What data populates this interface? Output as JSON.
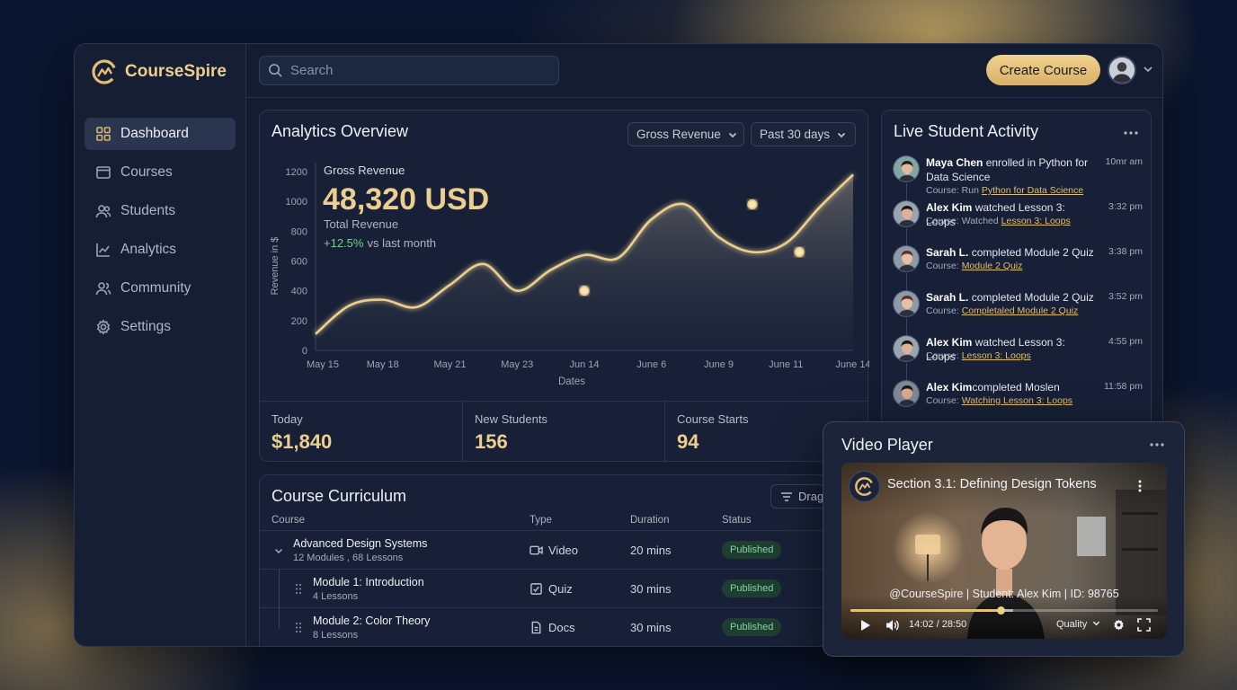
{
  "brand": {
    "name": "CourseSpire"
  },
  "colors": {
    "accent": "#e6c079",
    "background": "#0b1630",
    "panel": "#172036",
    "success": "#7fd6a0"
  },
  "sidebar": {
    "items": [
      {
        "label": "Dashboard",
        "icon": "dashboard-icon",
        "active": true
      },
      {
        "label": "Courses",
        "icon": "courses-icon"
      },
      {
        "label": "Students",
        "icon": "students-icon"
      },
      {
        "label": "Analytics",
        "icon": "analytics-icon"
      },
      {
        "label": "Community",
        "icon": "community-icon"
      },
      {
        "label": "Settings",
        "icon": "settings-icon"
      }
    ]
  },
  "topbar": {
    "search_placeholder": "Search",
    "create_label": "Create Course"
  },
  "analytics": {
    "title": "Analytics Overview",
    "metric_dropdown": "Gross Revenue",
    "range_dropdown": "Past 30 days",
    "overlay_label": "Gross Revenue",
    "overlay_value": "48,320 USD",
    "overlay_sub": "Total Revenue",
    "overlay_change": "+12.5%",
    "overlay_change_suffix": "vs last month"
  },
  "chart_data": {
    "type": "area",
    "title": "",
    "xlabel": "Dates",
    "ylabel": "Revenue in $",
    "ylim": [
      0,
      1200
    ],
    "yticks": [
      0,
      200,
      400,
      600,
      800,
      1000,
      1200
    ],
    "categories": [
      "May 15",
      "May 18",
      "May 21",
      "May 23",
      "Jun 14",
      "June 6",
      "June 9",
      "June 11",
      "June 14"
    ],
    "x": [
      0,
      0.5,
      1,
      1.5,
      2,
      2.5,
      3,
      3.5,
      4,
      4.5,
      5,
      5.5,
      6,
      6.5,
      7,
      7.5,
      8
    ],
    "values": [
      110,
      300,
      340,
      290,
      440,
      580,
      400,
      540,
      640,
      620,
      880,
      980,
      760,
      660,
      720,
      960,
      1180
    ],
    "highlighted": [
      {
        "x": 4,
        "value": 400
      },
      {
        "x": 6.5,
        "value": 980
      },
      {
        "x": 7.2,
        "value": 660
      }
    ],
    "grid": false
  },
  "stats": [
    {
      "label": "Today",
      "value": "$1,840"
    },
    {
      "label": "New Students",
      "value": "156"
    },
    {
      "label": "Course Starts",
      "value": "94"
    }
  ],
  "activity": {
    "title": "Live Student Activity",
    "items": [
      {
        "name": "Maya Chen",
        "action": " enrolled in Python for Data Science",
        "sub_prefix": "Course: Run ",
        "sub_link": "Python for Data Science",
        "time": "10mr am",
        "avatar": "female-1"
      },
      {
        "name": "Alex Kim",
        "action": " watched Lesson 3: Loops",
        "sub_prefix": "Course: Watched ",
        "sub_link": "Lesson 3: Loops",
        "time": "3:32 pm",
        "avatar": "male-1"
      },
      {
        "name": "Sarah L.",
        "action": " completed Module 2 Quiz",
        "sub_prefix": "Course: ",
        "sub_link": "Module 2 Quiz",
        "time": "3:38 pm",
        "avatar": "female-2"
      },
      {
        "name": "Sarah L.",
        "action": " completed Module 2 Quiz",
        "sub_prefix": "Course: ",
        "sub_link": "Completaled Module 2 Quiz",
        "time": "3:52 pm",
        "avatar": "female-2"
      },
      {
        "name": "Alex Kim",
        "action": " watched Lesson 3: Loops",
        "sub_prefix": "Course: ",
        "sub_link": "Lesson 3: Loops",
        "time": "4:55 pm",
        "avatar": "male-1"
      },
      {
        "name": "Alex Kim",
        "action": "completed Moslen",
        "sub_prefix": "Course: ",
        "sub_link": "Watching Lesson 3: Loops",
        "time": "11:58 pm",
        "avatar": "male-2"
      }
    ]
  },
  "curriculum": {
    "title": "Course Curriculum",
    "filter_label": "Drag",
    "headers": [
      "Course",
      "Type",
      "Duration",
      "Status"
    ],
    "rows": [
      {
        "name": "Advanced Design Systems",
        "sub": "12 Modules , 68 Lessons",
        "type": "Video",
        "type_icon": "video-icon",
        "duration": "20 mins",
        "status": "Published",
        "level": 0
      },
      {
        "name": "Module 1: Introduction",
        "sub": "4 Lessons",
        "type": "Quiz",
        "type_icon": "quiz-icon",
        "duration": "30 mins",
        "status": "Published",
        "level": 1
      },
      {
        "name": "Module 2: Color Theory",
        "sub": "8 Lessons",
        "type": "Docs",
        "type_icon": "docs-icon",
        "duration": "30 mins",
        "status": "Published",
        "level": 1
      }
    ]
  },
  "video": {
    "title": "Video Player",
    "section_title": "Section 3.1: Defining Design Tokens",
    "watermark": "@CourseSpire | Student: Alex Kim | ID: 98765",
    "time": "14:02 / 28:50",
    "quality": "Quality",
    "progress": 0.49,
    "buffered": 0.53
  }
}
